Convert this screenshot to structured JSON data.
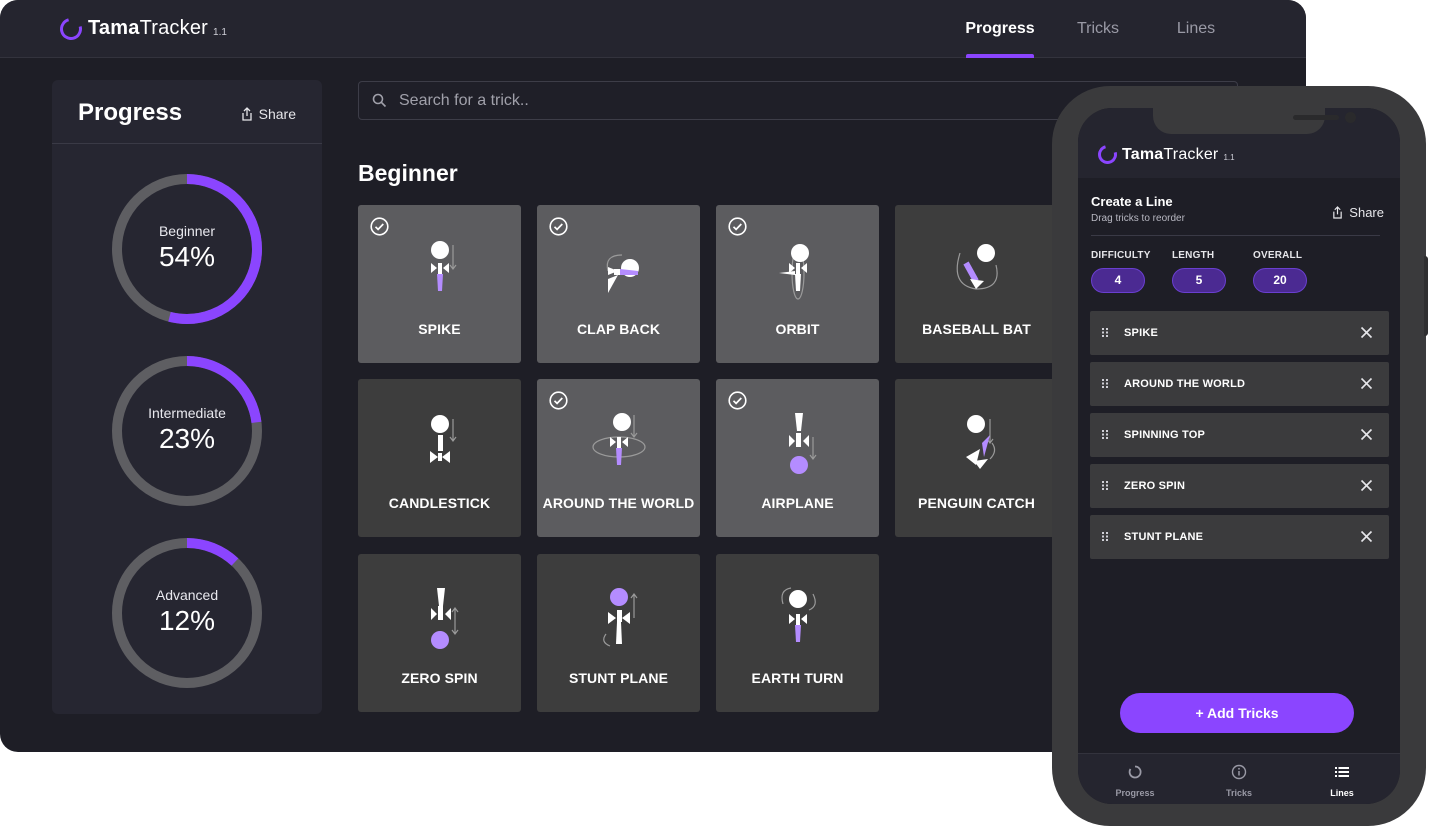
{
  "app": {
    "name_bold": "Tama",
    "name_light": "Tracker",
    "version": "1.1"
  },
  "nav": {
    "tabs": [
      "Progress",
      "Tricks",
      "Lines"
    ],
    "active": "Progress"
  },
  "progress": {
    "title": "Progress",
    "share_label": "Share",
    "levels": [
      {
        "name": "Beginner",
        "percent_label": "54%",
        "fraction": 0.54
      },
      {
        "name": "Intermediate",
        "percent_label": "23%",
        "fraction": 0.23
      },
      {
        "name": "Advanced",
        "percent_label": "12%",
        "fraction": 0.12
      }
    ]
  },
  "search": {
    "placeholder": "Search for a trick.."
  },
  "section": {
    "title": "Beginner"
  },
  "tricks": [
    {
      "name": "SPIKE",
      "completed": true
    },
    {
      "name": "CLAP BACK",
      "completed": true
    },
    {
      "name": "ORBIT",
      "completed": true
    },
    {
      "name": "BASEBALL BAT",
      "completed": false
    },
    {
      "name": "CANDLESTICK",
      "completed": false
    },
    {
      "name": "AROUND THE WORLD",
      "completed": true
    },
    {
      "name": "AIRPLANE",
      "completed": true
    },
    {
      "name": "PENGUIN CATCH",
      "completed": false
    },
    {
      "name": "ZERO SPIN",
      "completed": false
    },
    {
      "name": "STUNT PLANE",
      "completed": false
    },
    {
      "name": "EARTH TURN",
      "completed": false
    }
  ],
  "phone": {
    "line": {
      "title": "Create a Line",
      "subtitle": "Drag tricks to reorder",
      "share_label": "Share"
    },
    "stats": [
      {
        "label": "DIFFICULTY",
        "value": "4"
      },
      {
        "label": "LENGTH",
        "value": "5"
      },
      {
        "label": "OVERALL",
        "value": "20"
      }
    ],
    "line_items": [
      "SPIKE",
      "AROUND THE WORLD",
      "SPINNING TOP",
      "ZERO SPIN",
      "STUNT PLANE"
    ],
    "add_button": "+ Add Tricks",
    "tabbar": [
      {
        "label": "Progress",
        "icon": "progress-ring-icon"
      },
      {
        "label": "Tricks",
        "icon": "info-icon"
      },
      {
        "label": "Lines",
        "icon": "list-icon"
      }
    ],
    "tabbar_active": "Lines"
  },
  "colors": {
    "accent": "#8b45ff",
    "background": "#1e1e26",
    "card_done": "#5c5c5f",
    "card_todo": "#3d3d3d",
    "kendama_purple": "#b48cff"
  }
}
